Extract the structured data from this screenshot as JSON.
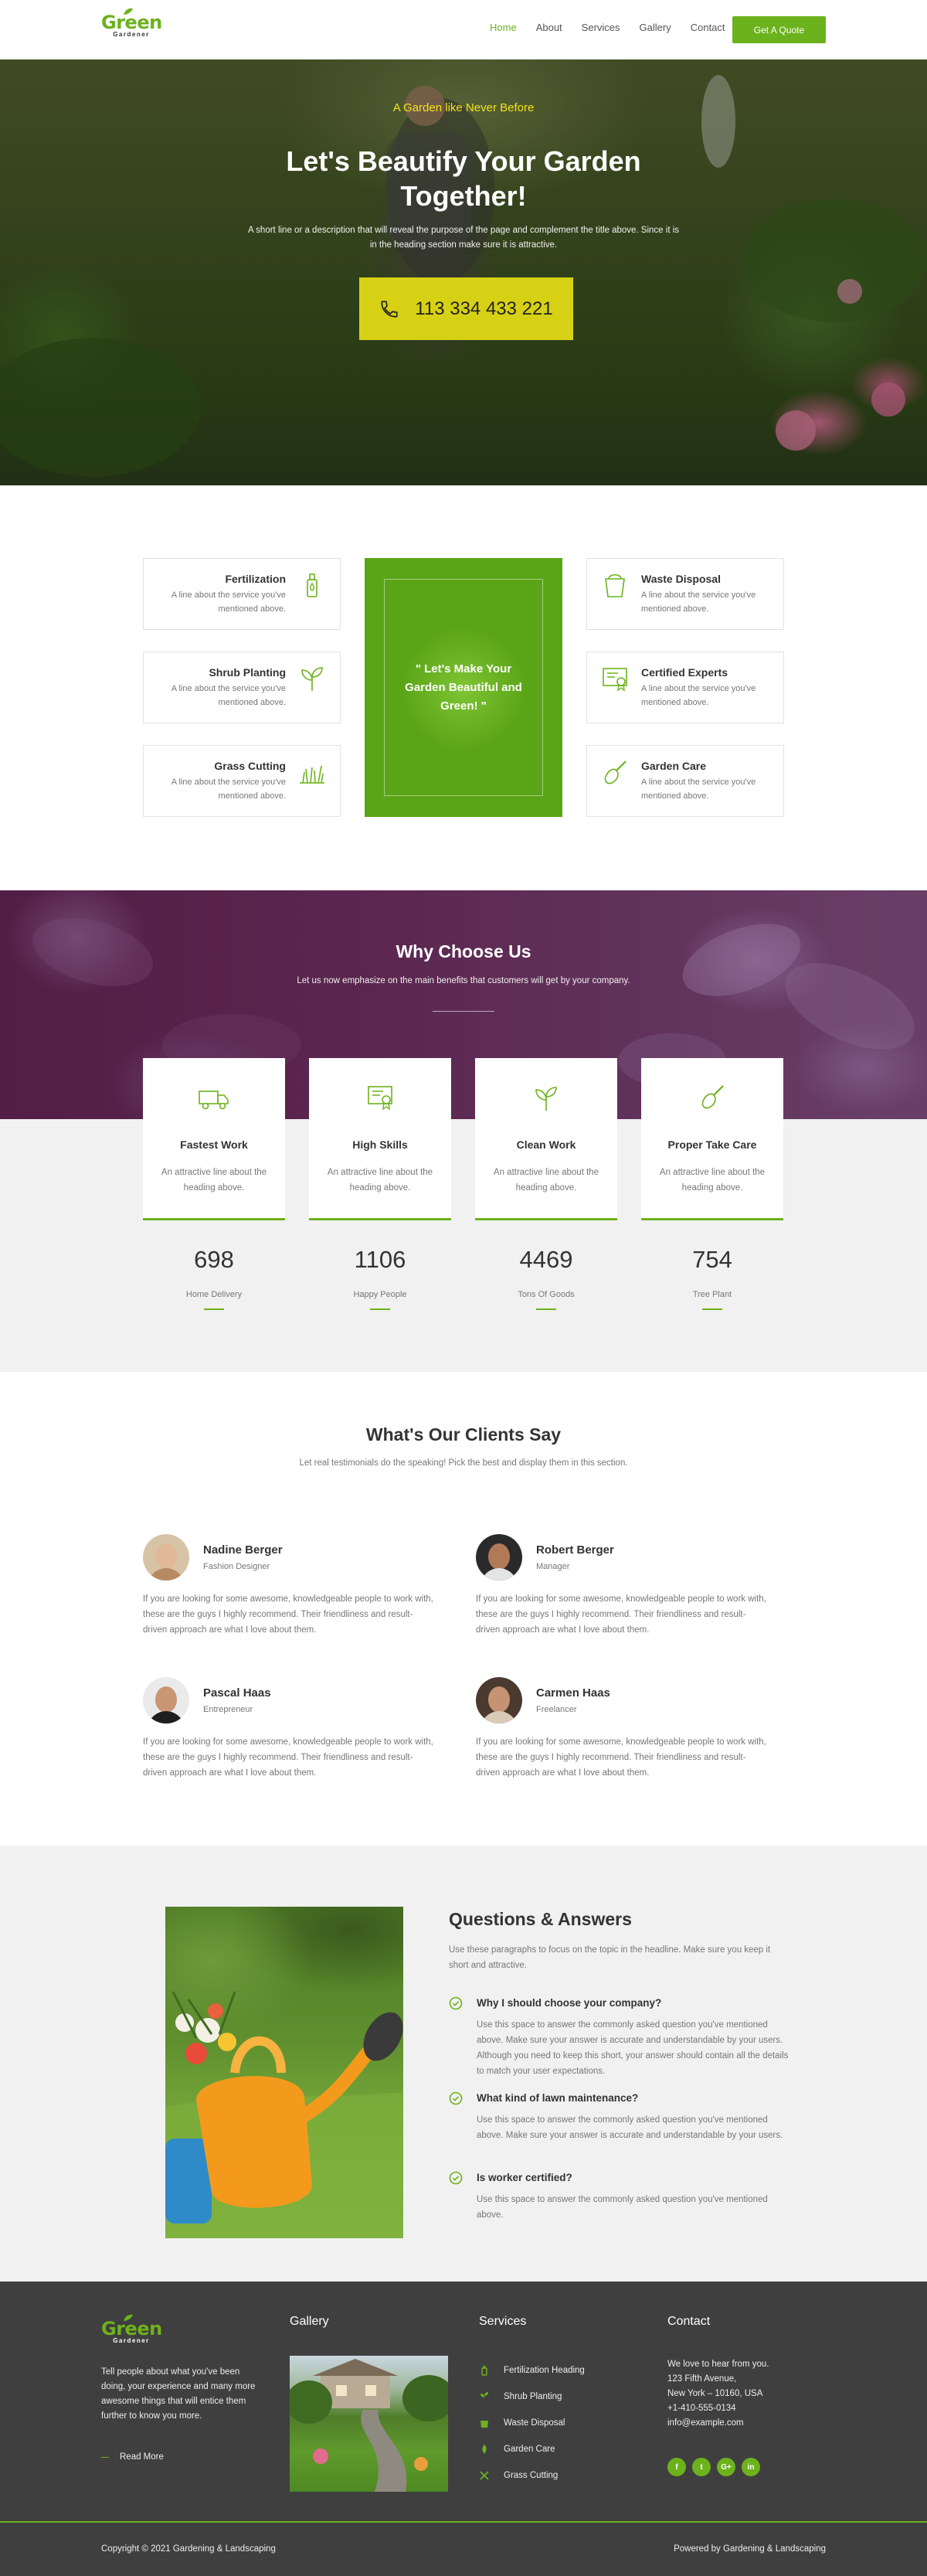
{
  "header": {
    "logo_top": "Green",
    "logo_bottom": "Gardener",
    "nav": [
      "Home",
      "About",
      "Services",
      "Gallery",
      "Contact"
    ],
    "active_nav": "Home",
    "cta": "Get A Quote"
  },
  "hero": {
    "tagline": "A Garden like Never Before",
    "title": "Let's Beautify Your Garden Together!",
    "description": "A short line or a description that will reveal the purpose of the page and complement the title above. Since it is in the heading section make sure it is attractive.",
    "phone": "113 334 433 221"
  },
  "services": {
    "items": [
      {
        "title": "Fertilization",
        "desc": "A line about the service you've mentioned above.",
        "icon": "bottle-icon"
      },
      {
        "title": "Shrub Planting",
        "desc": "A line about the service you've mentioned above.",
        "icon": "sprout-icon"
      },
      {
        "title": "Grass Cutting",
        "desc": "A line about the service you've mentioned above.",
        "icon": "grass-icon"
      },
      {
        "title": "Waste Disposal",
        "desc": "A line about the service you've mentioned above.",
        "icon": "bucket-icon"
      },
      {
        "title": "Certified Experts",
        "desc": "A line about the service you've mentioned above.",
        "icon": "certificate-icon"
      },
      {
        "title": "Garden Care",
        "desc": "A line about the service you've mentioned above.",
        "icon": "trowel-icon"
      }
    ],
    "center_quote": "\" Let's Make Your Garden Beautiful and Green! \""
  },
  "why": {
    "title": "Why Choose Us",
    "subtitle": "Let us now emphasize on the main benefits that customers will get by your company.",
    "features": [
      {
        "title": "Fastest Work",
        "desc": "An attractive line about the heading above.",
        "icon": "truck-icon"
      },
      {
        "title": "High Skills",
        "desc": "An attractive line about the heading above.",
        "icon": "certificate-icon"
      },
      {
        "title": "Clean Work",
        "desc": "An attractive line about the heading above.",
        "icon": "sprout-icon"
      },
      {
        "title": "Proper Take Care",
        "desc": "An attractive line about the heading above.",
        "icon": "trowel-icon"
      }
    ],
    "stats": [
      {
        "number": "698",
        "label": "Home Delivery"
      },
      {
        "number": "1106",
        "label": "Happy People"
      },
      {
        "number": "4469",
        "label": "Tons Of Goods"
      },
      {
        "number": "754",
        "label": "Tree Plant"
      }
    ]
  },
  "clients": {
    "title": "What's Our Clients Say",
    "subtitle": "Let real testimonials do the speaking! Pick the best and display them in this section.",
    "testimonials": [
      {
        "name": "Nadine Berger",
        "role": "Fashion Designer",
        "quote": "If you are looking for some awesome, knowledgeable people to work with, these are the guys I highly recommend. Their friendliness and result-driven approach are what I love about them."
      },
      {
        "name": "Robert Berger",
        "role": "Manager",
        "quote": "If you are looking for some awesome, knowledgeable people to work with, these are the guys I highly recommend. Their friendliness and result-driven approach are what I love about them."
      },
      {
        "name": "Pascal Haas",
        "role": "Entrepreneur",
        "quote": "If you are looking for some awesome, knowledgeable people to work with, these are the guys I highly recommend. Their friendliness and result-driven approach are what I love about them."
      },
      {
        "name": "Carmen Haas",
        "role": "Freelancer",
        "quote": "If you are looking for some awesome, knowledgeable people to work with, these are the guys I highly recommend. Their friendliness and result-driven approach are what I love about them."
      }
    ]
  },
  "faq": {
    "title": "Questions & Answers",
    "intro": "Use these paragraphs to focus on the topic in the headline. Make sure you keep it short and attractive.",
    "items": [
      {
        "q": "Why I should choose your company?",
        "a": "Use this space to answer the commonly asked question you've mentioned above. Make sure your answer is accurate and understandable by your users. Although you need to keep this short, your answer should contain all the details to match your user expectations."
      },
      {
        "q": "What kind of lawn maintenance?",
        "a": "Use this space to answer the commonly asked question you've mentioned above. Make sure your answer is accurate and understandable by your users."
      },
      {
        "q": "Is worker certified?",
        "a": "Use this space to answer the commonly asked question you've mentioned above."
      }
    ]
  },
  "footer": {
    "about": "Tell people about what you've been doing, your experience and many more awesome things that will entice them further to know you more.",
    "read_more": "Read More",
    "gallery_title": "Gallery",
    "services_title": "Services",
    "services": [
      "Fertilization Heading",
      "Shrub Planting",
      "Waste Disposal",
      "Garden Care",
      "Grass Cutting"
    ],
    "contact_title": "Contact",
    "contact_lines": [
      "We love to hear from you.",
      "123 Fifth Avenue,",
      "New York – 10160, USA",
      "+1-410-555-0134",
      "info@example.com"
    ],
    "socials": [
      "f",
      "t",
      "G+",
      "in"
    ],
    "copyright": "Copyright © 2021 Gardening & Landscaping",
    "powered": "Powered by Gardening & Landscaping"
  },
  "colors": {
    "accent": "#6cb21c",
    "yellow": "#d7d116",
    "footer_bg": "#3f3f3f",
    "light_bg": "#f1f1f1"
  }
}
